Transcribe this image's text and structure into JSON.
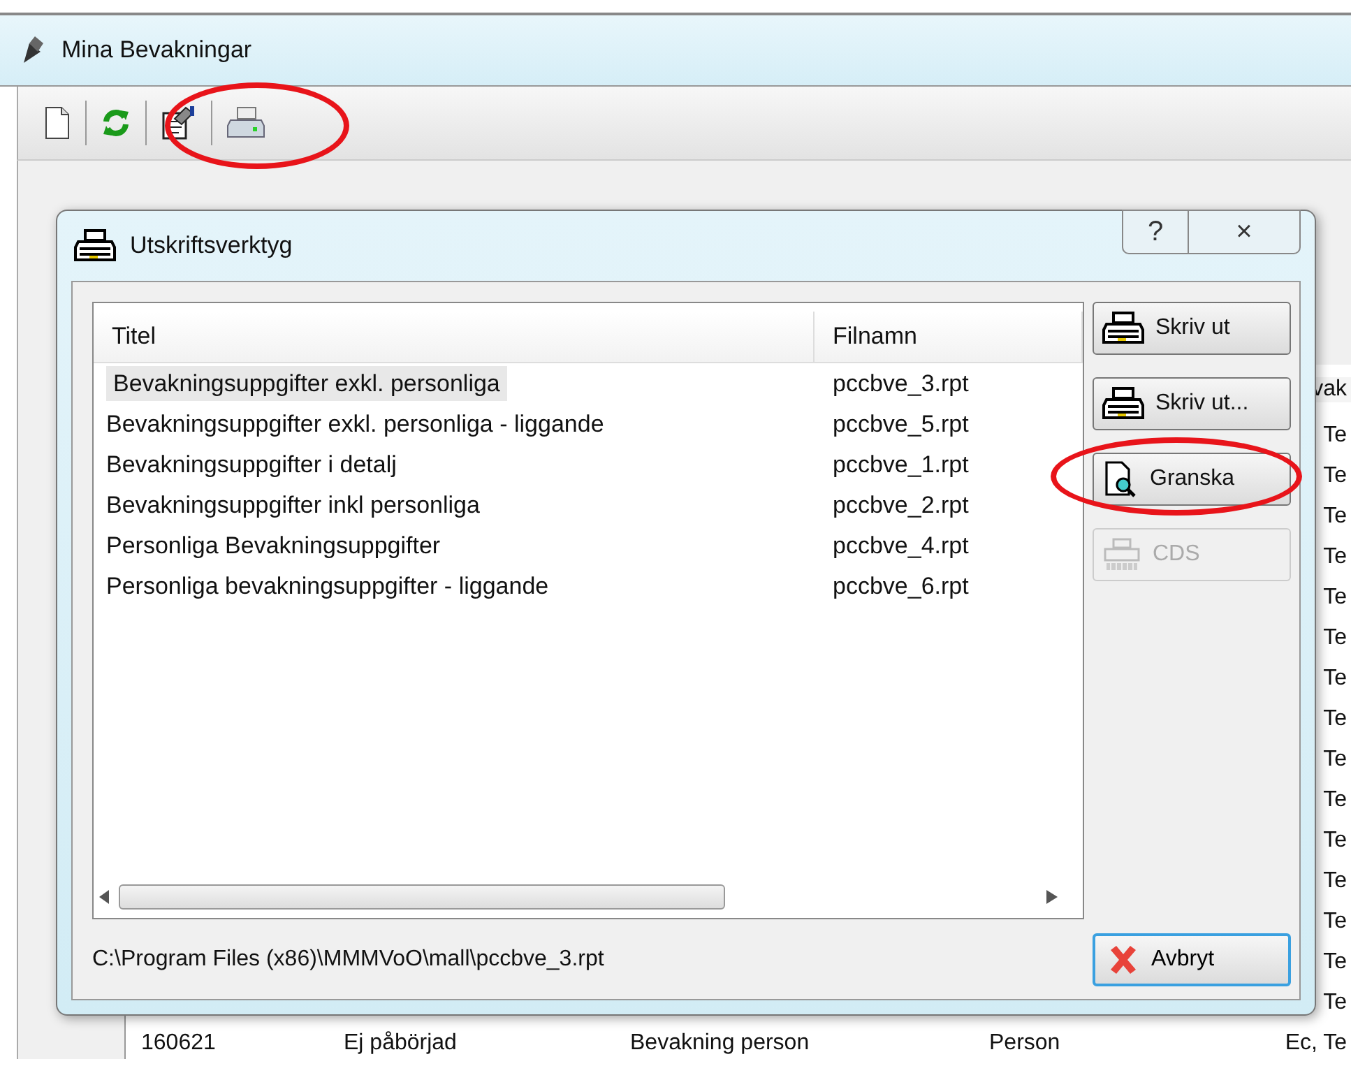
{
  "main_window": {
    "title": "Mina Bevakningar",
    "toolbar": [
      {
        "kind": "new-document",
        "circled": false
      },
      {
        "kind": "refresh",
        "circled": false
      },
      {
        "kind": "properties",
        "circled": false
      },
      {
        "kind": "print",
        "circled": true
      }
    ],
    "background_list": {
      "column_5_header": "vak",
      "rows": [
        {
          "column_5": "Te"
        },
        {
          "column_5": "Te"
        },
        {
          "column_5": "Te"
        },
        {
          "column_5": "Te"
        },
        {
          "column_5": "Te"
        },
        {
          "column_5": "Te"
        },
        {
          "column_5": "Te"
        },
        {
          "column_5": "Te"
        },
        {
          "column_5": "Te"
        },
        {
          "column_5": "Te"
        },
        {
          "column_5": "Te"
        },
        {
          "column_5": "Te"
        },
        {
          "column_5": "Te"
        },
        {
          "column_5": "Te"
        },
        {
          "column_5": "Te"
        },
        {
          "column_1": "160621",
          "column_2": "Ej påbörjad",
          "column_3": "Bevakning person",
          "column_4": "Person",
          "column_5": "Ec, Te"
        }
      ]
    }
  },
  "dialog": {
    "title": "Utskriftsverktyg",
    "help": "?",
    "close": "×",
    "table": {
      "columns": [
        "Titel",
        "Filnamn"
      ],
      "rows": [
        {
          "title": "Bevakningsuppgifter exkl. personliga",
          "file": "pccbve_3.rpt",
          "selected": true
        },
        {
          "title": "Bevakningsuppgifter exkl. personliga - liggande",
          "file": "pccbve_5.rpt",
          "selected": false
        },
        {
          "title": "Bevakningsuppgifter i detalj",
          "file": "pccbve_1.rpt",
          "selected": false
        },
        {
          "title": "Bevakningsuppgifter inkl personliga",
          "file": "pccbve_2.rpt",
          "selected": false
        },
        {
          "title": "Personliga Bevakningsuppgifter",
          "file": "pccbve_4.rpt",
          "selected": false
        },
        {
          "title": "Personliga bevakningsuppgifter - liggande",
          "file": "pccbve_6.rpt",
          "selected": false
        }
      ]
    },
    "path": "C:\\Program Files (x86)\\MMMVoO\\mall\\pccbve_3.rpt",
    "buttons": [
      {
        "label": "Skriv ut",
        "kind": "print",
        "disabled": false,
        "circled": false
      },
      {
        "label": "Skriv ut...",
        "kind": "print",
        "disabled": false,
        "circled": false
      },
      {
        "label": "Granska",
        "kind": "preview",
        "disabled": false,
        "circled": true
      },
      {
        "label": "CDS",
        "kind": "cds",
        "disabled": true,
        "circled": false
      }
    ],
    "cancel": {
      "label": "Avbryt",
      "focused": true
    }
  }
}
